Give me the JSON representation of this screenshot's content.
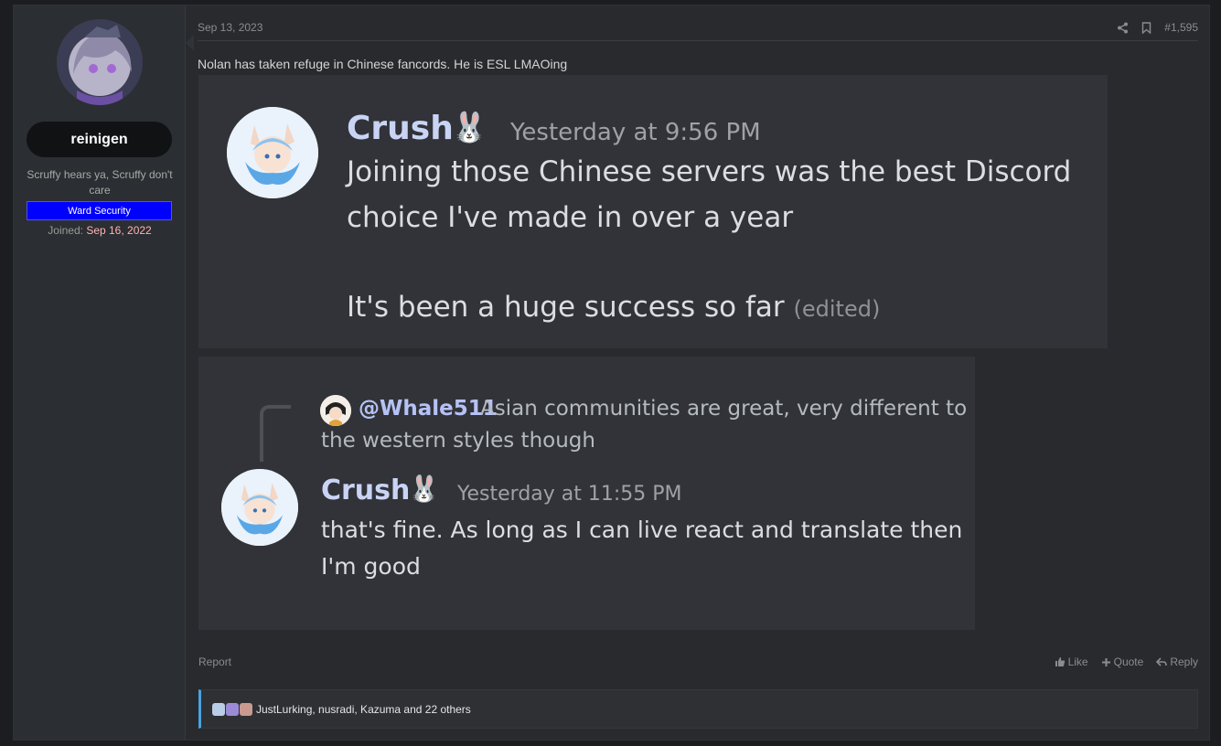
{
  "user": {
    "name": "reinigen",
    "title": "Scruffy hears ya, Scruffy don't care",
    "banner": "Ward Security",
    "joined_label": "Joined:",
    "joined_date": "Sep 16, 2022"
  },
  "post": {
    "date": "Sep 13, 2023",
    "number": "#1,595",
    "message": "Nolan has taken refuge in Chinese fancords. He is ESL LMAOing"
  },
  "embed1": {
    "author": "Crush",
    "emoji": "🐰",
    "timestamp": "Yesterday at 9:56 PM",
    "line1": "Joining those Chinese servers was the best Discord",
    "line2": "choice I've made in over a year",
    "line3": "It's been a huge success so far",
    "edited": "(edited)"
  },
  "embed2": {
    "reply_to": "@Whale511",
    "reply_text1": "Asian communities are great, very different to",
    "reply_text2": "the western styles though",
    "author": "Crush",
    "emoji": "🐰",
    "timestamp": "Yesterday at 11:55 PM",
    "line1": "that's fine. As long as I can live react and translate then",
    "line2": "I'm good"
  },
  "footer": {
    "report": "Report",
    "like": "Like",
    "quote": "Quote",
    "reply": "Reply"
  },
  "reactions": {
    "text": "JustLurking, nusradi, Kazuma and 22 others"
  },
  "colors": {
    "badge": "#0000ff",
    "joined_date": "#ffb3b3",
    "reaction_accent": "#4aa3df"
  }
}
